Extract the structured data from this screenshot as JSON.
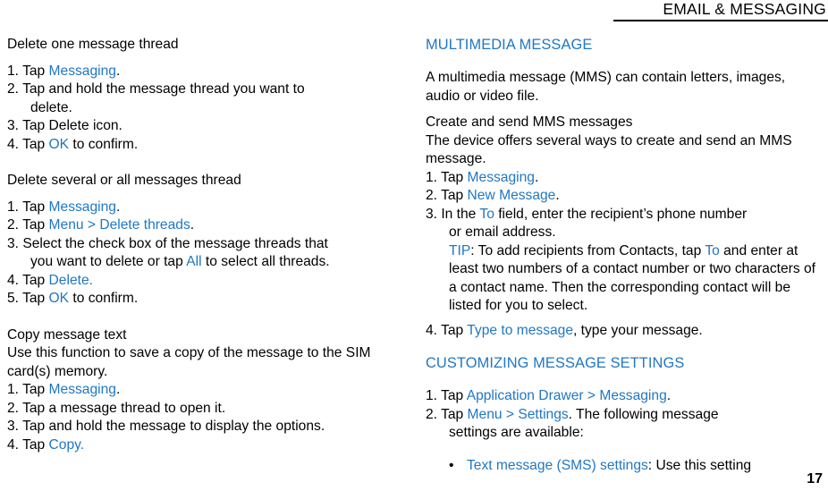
{
  "header": {
    "title": "EMAIL & MESSAGING"
  },
  "folio": {
    "page_number": "17"
  },
  "colors": {
    "link": "#2077c4",
    "text": "#000000",
    "background": "#ffffff"
  },
  "left_column": {
    "section_delete_one": {
      "heading": "Delete one message thread",
      "steps": [
        {
          "num": "1. ",
          "pre": "Tap ",
          "link": "Messaging",
          "post": "."
        },
        {
          "num": "2. ",
          "pre": "Tap and hold the message thread you want to",
          "link": "",
          "post": ""
        },
        {
          "cont": "delete."
        },
        {
          "num": "3. ",
          "pre": "Tap Delete icon.",
          "link": "",
          "post": ""
        },
        {
          "num": "4. ",
          "pre": "Tap ",
          "link": "OK",
          "post": " to confirm."
        }
      ]
    },
    "section_delete_several": {
      "heading": "Delete several or all messages thread",
      "steps": [
        {
          "num": "1. ",
          "pre": "Tap ",
          "link": "Messaging",
          "post": "."
        },
        {
          "num": "2. ",
          "pre": "Tap ",
          "link": "Menu > Delete threads",
          "post": "."
        },
        {
          "num": "3. ",
          "pre": "Select the check box of the message threads that",
          "link": "",
          "post": ""
        },
        {
          "cont_pre": "you want to delete or tap ",
          "cont_link": "All",
          "cont_post": " to select all threads."
        },
        {
          "num": "4. ",
          "pre": "Tap ",
          "link": "Delete.",
          "post": ""
        },
        {
          "num": "5. ",
          "pre": "Tap ",
          "link": "OK",
          "post": " to confirm."
        }
      ]
    },
    "section_copy": {
      "heading": "Copy message text",
      "intro": "Use this function to save a copy of the message to the SIM card(s) memory.",
      "steps": [
        {
          "num": "1. ",
          "pre": "Tap ",
          "link": "Messaging",
          "post": "."
        },
        {
          "num": "2. ",
          "pre": "Tap a message thread to open it.",
          "link": "",
          "post": ""
        },
        {
          "num": "3. ",
          "pre": "Tap and hold the message to display the options.",
          "link": "",
          "post": ""
        },
        {
          "num": "4. ",
          "pre": "Tap ",
          "link": "Copy.",
          "post": ""
        }
      ]
    }
  },
  "right_column": {
    "section_mms": {
      "heading": "MULTIMEDIA MESSAGE",
      "intro": "A multimedia message (MMS) can contain letters, images, audio or video file.",
      "subheading": "Create and send MMS messages",
      "subintro": "The device offers several ways to create and send an MMS message.",
      "steps": [
        {
          "num": "1. ",
          "pre": "Tap ",
          "link": "Messaging",
          "post": "."
        },
        {
          "num": "2. ",
          "pre": "Tap ",
          "link": "New Message",
          "post": "."
        },
        {
          "num": "3. ",
          "pre": "In the ",
          "link": "To",
          "post": " field, enter the recipient’s phone number"
        },
        {
          "cont": "or email address."
        },
        {
          "tip_link": "TIP",
          "tip_pre": ": To add recipients from Contacts, tap ",
          "tip_link2": "To",
          "tip_post": " and enter at least two numbers of a contact number or two characters of a contact name. Then the corresponding contact will be listed for you to select."
        },
        {
          "num": "4. ",
          "pre": "Tap ",
          "link": "Type to message",
          "post": ", type your message."
        }
      ]
    },
    "section_settings": {
      "heading": "CUSTOMIZING MESSAGE SETTINGS",
      "steps": [
        {
          "num": "1. ",
          "pre": "Tap ",
          "link": "Application Drawer > Messaging",
          "post": "."
        },
        {
          "num": "2. ",
          "pre": "Tap ",
          "link": "Menu > Settings",
          "post": ". The following message"
        },
        {
          "cont": "settings are available:"
        }
      ],
      "bullets": [
        {
          "marker": "•",
          "link": "Text message (SMS) settings",
          "post": ": Use this setting"
        }
      ]
    }
  }
}
